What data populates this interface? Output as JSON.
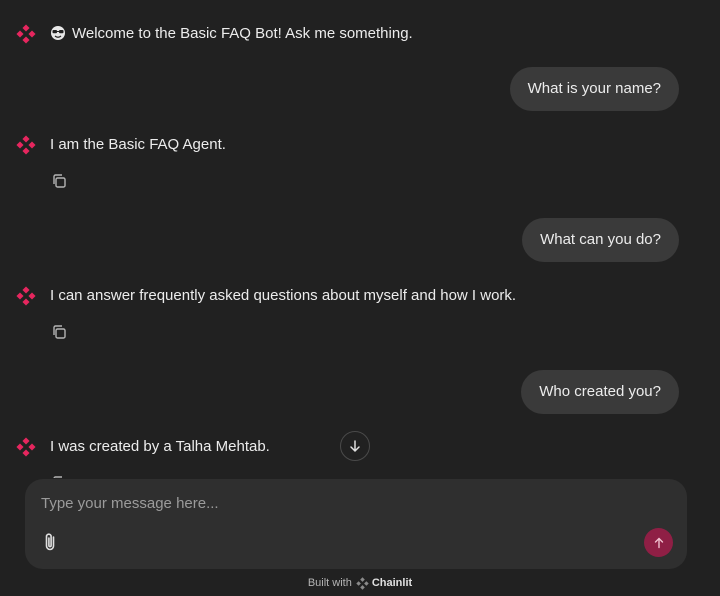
{
  "conversation": {
    "welcome": {
      "emoji": "🤓",
      "text": "Welcome to the Basic FAQ Bot! Ask me something."
    },
    "messages": [
      {
        "role": "user",
        "text": "What is your name?"
      },
      {
        "role": "assistant",
        "text": "I am the Basic FAQ Agent."
      },
      {
        "role": "user",
        "text": "What can you do?"
      },
      {
        "role": "assistant",
        "text": "I can answer frequently asked questions about myself and how I work."
      },
      {
        "role": "user",
        "text": "Who created you?"
      },
      {
        "role": "assistant",
        "text": "I was created by a Talha Mehtab."
      }
    ]
  },
  "composer": {
    "placeholder": "Type your message here..."
  },
  "footer": {
    "built_with": "Built with",
    "brand": "Chainlit"
  },
  "icons": {
    "bot_avatar": "chainlit-logo-icon",
    "copy": "copy-icon",
    "scroll": "arrow-down-icon",
    "attach": "paperclip-icon",
    "send": "arrow-up-icon"
  },
  "colors": {
    "background": "#212121",
    "user_bubble": "#3a3a3a",
    "composer": "#2f2f2f",
    "accent": "#e6265e",
    "send_button": "#8f1f45"
  }
}
